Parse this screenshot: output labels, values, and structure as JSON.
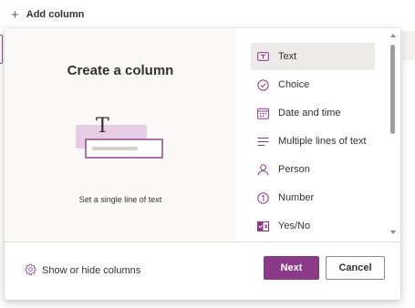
{
  "page": {
    "add_column_label": "Add column"
  },
  "dialog": {
    "title": "Create a column",
    "preview_description": "Set a single line of text",
    "types": [
      {
        "label": "Text",
        "icon": "text-box-icon",
        "selected": true
      },
      {
        "label": "Choice",
        "icon": "choice-check-icon",
        "selected": false
      },
      {
        "label": "Date and time",
        "icon": "calendar-icon",
        "selected": false
      },
      {
        "label": "Multiple lines of text",
        "icon": "multiline-text-icon",
        "selected": false
      },
      {
        "label": "Person",
        "icon": "person-icon",
        "selected": false
      },
      {
        "label": "Number",
        "icon": "number-icon",
        "selected": false
      },
      {
        "label": "Yes/No",
        "icon": "yes-no-toggle-icon",
        "selected": false
      }
    ],
    "footer": {
      "show_hide_label": "Show or hide columns",
      "next_label": "Next",
      "cancel_label": "Cancel"
    }
  },
  "colors": {
    "accent": "#8a3a86",
    "selected_bg": "#edebe9",
    "preview_bg": "#faf9f8"
  }
}
